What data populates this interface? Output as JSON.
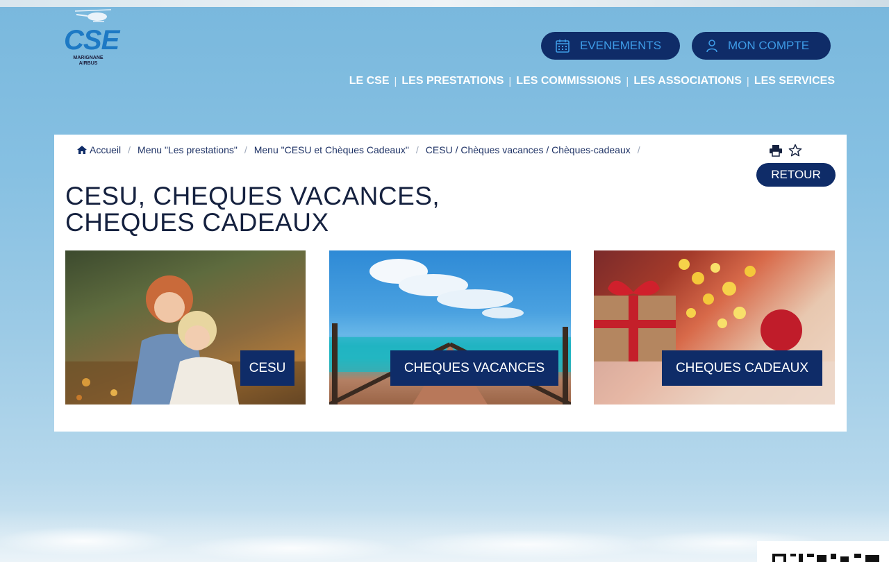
{
  "logo": {
    "name": "CSE",
    "subtitle_line1": "MARIGNANE",
    "subtitle_line2": "AIRBUS"
  },
  "header": {
    "events_label": "EVENEMENTS",
    "account_label": "MON COMPTE",
    "nav": [
      {
        "label": "LE CSE"
      },
      {
        "label": "LES PRESTATIONS"
      },
      {
        "label": "LES COMMISSIONS"
      },
      {
        "label": "LES ASSOCIATIONS"
      },
      {
        "label": "LES SERVICES"
      }
    ],
    "nav_separator": "|"
  },
  "breadcrumb": {
    "separator": "/",
    "items": [
      {
        "label": "Accueil"
      },
      {
        "label": "Menu \"Les prestations\""
      },
      {
        "label": "Menu \"CESU et Chèques Cadeaux\""
      },
      {
        "label": "CESU / Chèques vacances / Chèques-cadeaux"
      }
    ]
  },
  "page": {
    "retour_label": "RETOUR",
    "title_line1": "CESU, CHEQUES VACANCES,",
    "title_line2": "CHEQUES CADEAUX"
  },
  "tiles": [
    {
      "label": "CESU"
    },
    {
      "label": "CHEQUES VACANCES"
    },
    {
      "label": "CHEQUES CADEAUX"
    }
  ],
  "colors": {
    "navy": "#0f2c68",
    "accent_blue": "#3e9be6",
    "logo_blue": "#1d79c4"
  }
}
